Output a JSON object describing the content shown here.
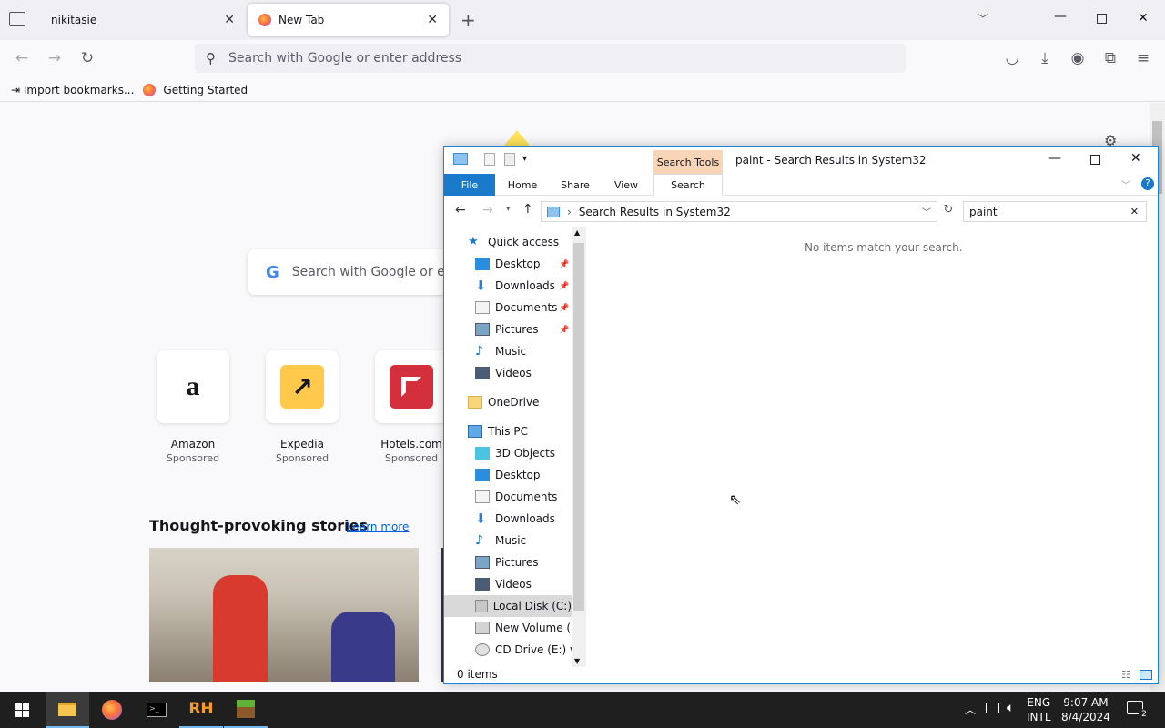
{
  "browser": {
    "tabs": [
      {
        "label": "nikitasie"
      },
      {
        "label": "New Tab"
      }
    ],
    "urlbar_placeholder": "Search with Google or enter address",
    "bookmarks": [
      {
        "label": "Import bookmarks..."
      },
      {
        "label": "Getting Started"
      }
    ]
  },
  "newtab": {
    "search_placeholder": "Search with Google or e",
    "shortcuts": [
      {
        "name": "Amazon",
        "tag": "Sponsored"
      },
      {
        "name": "Expedia",
        "tag": "Sponsored"
      },
      {
        "name": "Hotels.com",
        "tag": "Sponsored"
      }
    ],
    "stories_title": "Thought-provoking stories",
    "learn_more": "Learn more"
  },
  "explorer": {
    "title": "paint - Search Results in System32",
    "context_tab": "Search Tools",
    "ribbon_tabs": [
      "File",
      "Home",
      "Share",
      "View",
      "Search"
    ],
    "address": "Search Results in System32",
    "search_value": "paint",
    "empty_message": "No items match your search.",
    "status": "0 items",
    "nav": {
      "quick_access": "Quick access",
      "quick_items": [
        "Desktop",
        "Downloads",
        "Documents",
        "Pictures",
        "Music",
        "Videos"
      ],
      "onedrive": "OneDrive",
      "this_pc": "This PC",
      "pc_items": [
        "3D Objects",
        "Desktop",
        "Documents",
        "Downloads",
        "Music",
        "Pictures",
        "Videos",
        "Local Disk (C:)",
        "New Volume (D:",
        "CD Drive (E:) virt"
      ]
    }
  },
  "taskbar": {
    "lang1": "ENG",
    "lang2": "INTL",
    "time": "9:07 AM",
    "date": "8/4/2024",
    "notif_count": "2"
  },
  "colors": {
    "accent": "#1979ca",
    "taskbar": "#1f1f1f",
    "search_tools": "#f7d5b6"
  }
}
